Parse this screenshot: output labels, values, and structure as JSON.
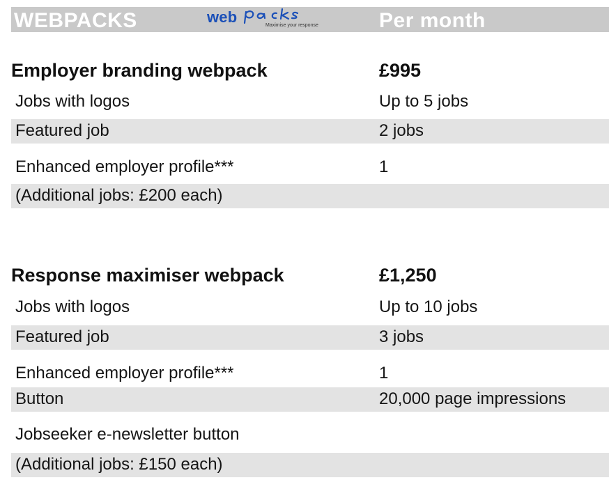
{
  "header": {
    "title": "WEBPACKS",
    "price_heading": "Per month",
    "logo": {
      "word_web": "web",
      "word_packs": "packs",
      "tagline": "Maximise your response",
      "brand_color": "#1b50b8"
    }
  },
  "colors": {
    "header_bg": "#c9c9c9",
    "row_shade": "#e3e3e3"
  },
  "packs": [
    {
      "title": "Employer branding webpack",
      "price": "£995",
      "rows": [
        {
          "label": "Jobs with logos",
          "value": "Up to 5 jobs",
          "shaded": false
        },
        {
          "label": "Featured job",
          "value": "2 jobs",
          "shaded": true
        },
        {
          "label": "Enhanced employer profile***",
          "value": "1",
          "shaded": false
        },
        {
          "label": "(Additional jobs: £200 each)",
          "value": "",
          "shaded": true
        }
      ]
    },
    {
      "title": "Response maximiser webpack",
      "price": "£1,250",
      "rows": [
        {
          "label": "Jobs with logos",
          "value": "Up to 10 jobs",
          "shaded": false
        },
        {
          "label": "Featured job",
          "value": "3 jobs",
          "shaded": true
        },
        {
          "label": "Enhanced employer profile***",
          "value": "1",
          "shaded": false
        },
        {
          "label": "Button",
          "value": "20,000 page impressions",
          "shaded": true
        },
        {
          "label": "Jobseeker e-newsletter button",
          "value": "",
          "shaded": false
        },
        {
          "label": "(Additional jobs: £150 each)",
          "value": "",
          "shaded": true
        }
      ]
    }
  ]
}
